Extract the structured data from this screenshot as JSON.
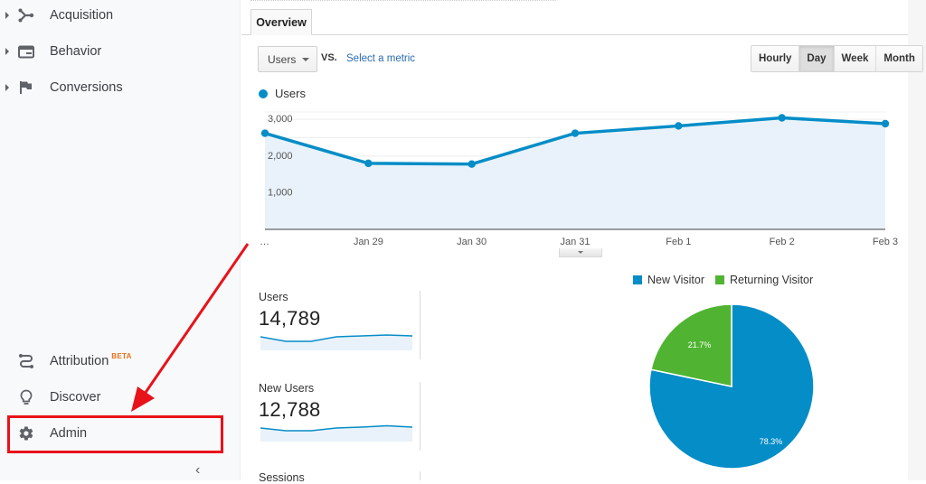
{
  "sidebar": {
    "items": [
      {
        "label": "Acquisition",
        "icon": "acquisition-icon",
        "expandable": true
      },
      {
        "label": "Behavior",
        "icon": "behavior-icon",
        "expandable": true
      },
      {
        "label": "Conversions",
        "icon": "flag-icon",
        "expandable": true
      }
    ],
    "bottom_items": [
      {
        "label": "Attribution",
        "badge": "BETA",
        "icon": "attribution-icon"
      },
      {
        "label": "Discover",
        "icon": "lightbulb-icon"
      },
      {
        "label": "Admin",
        "icon": "gear-icon",
        "highlighted": true
      }
    ],
    "collapse_icon": "‹"
  },
  "main": {
    "tabs": [
      {
        "label": "Overview",
        "active": true
      }
    ],
    "metric_select": {
      "value": "Users"
    },
    "vs_label": "VS.",
    "select_metric_link": "Select a metric",
    "period_buttons": [
      {
        "label": "Hourly",
        "active": false
      },
      {
        "label": "Day",
        "active": true
      },
      {
        "label": "Week",
        "active": false
      },
      {
        "label": "Month",
        "active": false
      }
    ],
    "series_legend": "Users"
  },
  "scorecards": [
    {
      "name": "Users",
      "value": "14,789"
    },
    {
      "name": "New Users",
      "value": "12,788"
    },
    {
      "name": "Sessions",
      "value": ""
    }
  ],
  "annotation": {
    "color": "#e8121a",
    "target": "Admin"
  },
  "colors": {
    "primary_blue": "#058dc7",
    "returning_green": "#50b432",
    "area_fill": "#e9f2fa",
    "link": "#2a6db0"
  },
  "chart_data": [
    {
      "type": "area",
      "title": "",
      "series": [
        {
          "name": "Users",
          "values": [
            2620,
            1800,
            1780,
            2620,
            2820,
            3040,
            2880
          ]
        }
      ],
      "x": [
        "…",
        "Jan 29",
        "Jan 30",
        "Jan 31",
        "Feb 1",
        "Feb 2",
        "Feb 3"
      ],
      "yticks": [
        "1,000",
        "2,000",
        "3,000"
      ],
      "ylim": [
        0,
        3200
      ],
      "grid": true,
      "legend": "top-left"
    },
    {
      "type": "pie",
      "slices": [
        {
          "label": "New Visitor",
          "value": 78.3,
          "display": "78.3%",
          "color": "#058dc7"
        },
        {
          "label": "Returning Visitor",
          "value": 21.7,
          "display": "21.7%",
          "color": "#50b432"
        }
      ],
      "legend": "top"
    }
  ]
}
